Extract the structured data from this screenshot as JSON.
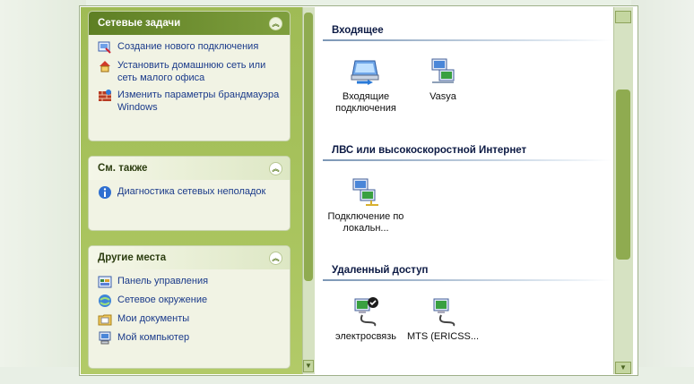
{
  "sidebar": {
    "network_tasks": {
      "title": "Сетевые задачи",
      "items": [
        {
          "label": "Создание нового подключения",
          "icon": "new-connection-icon"
        },
        {
          "label": "Установить домашнюю сеть или сеть малого офиса",
          "icon": "home-network-icon"
        },
        {
          "label": "Изменить параметры брандмауэра Windows",
          "icon": "firewall-icon"
        }
      ]
    },
    "see_also": {
      "title": "См. также",
      "items": [
        {
          "label": "Диагностика сетевых неполадок",
          "icon": "info-icon"
        }
      ]
    },
    "other_places": {
      "title": "Другие места",
      "items": [
        {
          "label": "Панель управления",
          "icon": "control-panel-icon"
        },
        {
          "label": "Сетевое окружение",
          "icon": "network-places-icon"
        },
        {
          "label": "Мои документы",
          "icon": "my-documents-icon"
        },
        {
          "label": "Мой компьютер",
          "icon": "my-computer-icon"
        }
      ]
    }
  },
  "content": {
    "groups": [
      {
        "title": "Входящее",
        "items": [
          {
            "label": "Входящие подключения",
            "icon": "incoming-connections-icon"
          },
          {
            "label": "Vasya",
            "icon": "network-connection-icon"
          }
        ]
      },
      {
        "title": "ЛВС или высокоскоростной Интернет",
        "items": [
          {
            "label": "Подключение по локальн...",
            "icon": "lan-connection-icon"
          }
        ]
      },
      {
        "title": "Удаленный доступ",
        "items": [
          {
            "label": "электросвязь",
            "icon": "dialup-default-icon"
          },
          {
            "label": "MTS (ERICSS...",
            "icon": "dialup-icon"
          }
        ]
      }
    ]
  },
  "colors": {
    "task_pane": "#a9c45e",
    "header_dark": "#5e7f24",
    "link": "#1a3a8a",
    "group_line": "#7c97b6"
  }
}
